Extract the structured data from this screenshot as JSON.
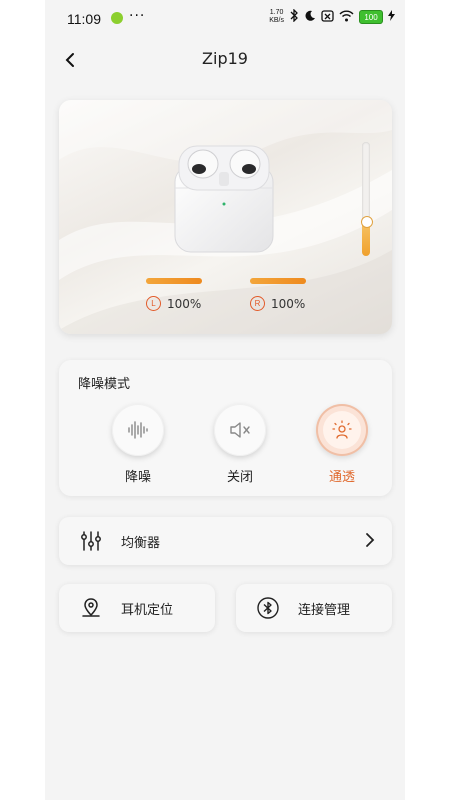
{
  "status_bar": {
    "time": "11:09",
    "more": "···",
    "speed_value": "1.70",
    "speed_unit": "KB/s",
    "battery": "100"
  },
  "header": {
    "back_icon": "chevron-left-icon",
    "title": "Zip19"
  },
  "earbuds": {
    "volume_level": 0.3,
    "left": {
      "badge": "L",
      "percent_text": "100%",
      "level": 1.0
    },
    "right": {
      "badge": "R",
      "percent_text": "100%",
      "level": 1.0
    },
    "colors": {
      "accent": "#F0A12D",
      "badge": "#E25B2A"
    }
  },
  "noise": {
    "title": "降噪模式",
    "modes": [
      {
        "label": "降噪",
        "icon": "sound-wave-icon",
        "active": false
      },
      {
        "label": "关闭",
        "icon": "speaker-mute-icon",
        "active": false
      },
      {
        "label": "通透",
        "icon": "ambient-user-icon",
        "active": true
      }
    ],
    "active_color": "#E06A2E"
  },
  "equalizer": {
    "label": "均衡器",
    "icon": "equalizer-sliders-icon"
  },
  "locate": {
    "label": "耳机定位",
    "icon": "location-pin-icon"
  },
  "connection": {
    "label": "连接管理",
    "icon": "bluetooth-icon"
  }
}
